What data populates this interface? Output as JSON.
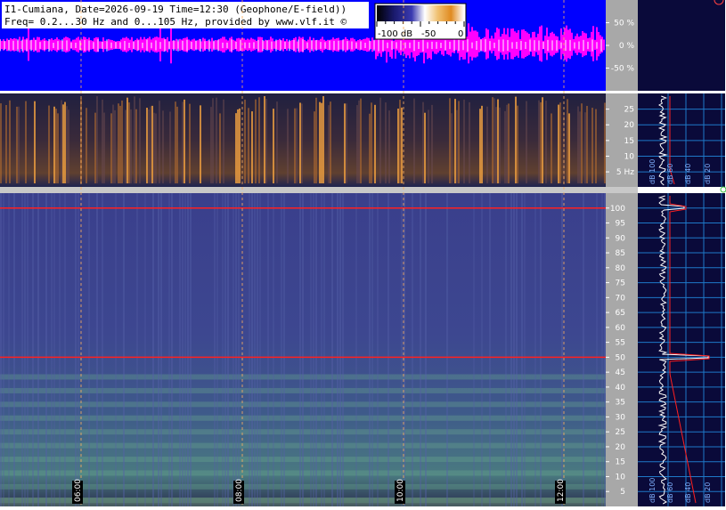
{
  "header": {
    "line1": "I1-Cumiana, Date=2026-09-19 Time=12:30 (Geophone/E-field))",
    "line2": "Freq= 0.2...30 Hz and 0...105 Hz, provided by www.vlf.it ©"
  },
  "colorbar": {
    "labels": [
      "-100 dB",
      "-50",
      "0"
    ],
    "colors": [
      "#000000",
      "#1a1a6e",
      "#3a3ab0",
      "#ffffff",
      "#f0c070",
      "#e08a20",
      "#ffffff"
    ]
  },
  "colors": {
    "waveform_background": "#0000ff",
    "waveform_trace": "#ff00ff",
    "waveform_peaks": "#ffffff",
    "axis_panel": "#a8a8a8",
    "profile_background": "#0a0a3a",
    "profile_grid": "#1e78c8",
    "low_spec_background": "#1a1a40",
    "high_spec_background": "#3a3f8c",
    "marker_line": "#ff2020",
    "time_grid": "#ffb060"
  },
  "chart_data": [
    {
      "type": "line",
      "panel": "waveform",
      "y_ticks": [
        "50 %",
        "0 %",
        "-50 %"
      ],
      "y_tick_values": [
        50,
        0,
        -50
      ],
      "ylim": [
        -100,
        100
      ]
    },
    {
      "type": "heatmap",
      "panel": "spectrogram-0.2-30Hz",
      "y_ticks": [
        "25",
        "20",
        "15",
        "10",
        "5 Hz"
      ],
      "y_tick_values": [
        25,
        20,
        15,
        10,
        5
      ],
      "ylim": [
        0.2,
        30
      ],
      "grid": true,
      "profile_labels": [
        "dB 100",
        "dB 60",
        "dB 40",
        "dB 20"
      ]
    },
    {
      "type": "heatmap",
      "panel": "spectrogram-0-105Hz",
      "x_ticks": [
        "06:00",
        "08:00",
        "10:00",
        "12:00"
      ],
      "y_ticks": [
        "100",
        "95",
        "90",
        "85",
        "80",
        "75",
        "70",
        "65",
        "60",
        "55",
        "50",
        "45",
        "40",
        "35",
        "30",
        "25",
        "20",
        "15",
        "10",
        "5"
      ],
      "y_tick_values": [
        100,
        95,
        90,
        85,
        80,
        75,
        70,
        65,
        60,
        55,
        50,
        45,
        40,
        35,
        30,
        25,
        20,
        15,
        10,
        5
      ],
      "ylim": [
        0,
        105
      ],
      "marked_lines_hz": [
        100,
        50
      ],
      "grid": true,
      "profile_labels": [
        "dB 100",
        "dB 60",
        "dB 40",
        "dB 20"
      ]
    }
  ]
}
